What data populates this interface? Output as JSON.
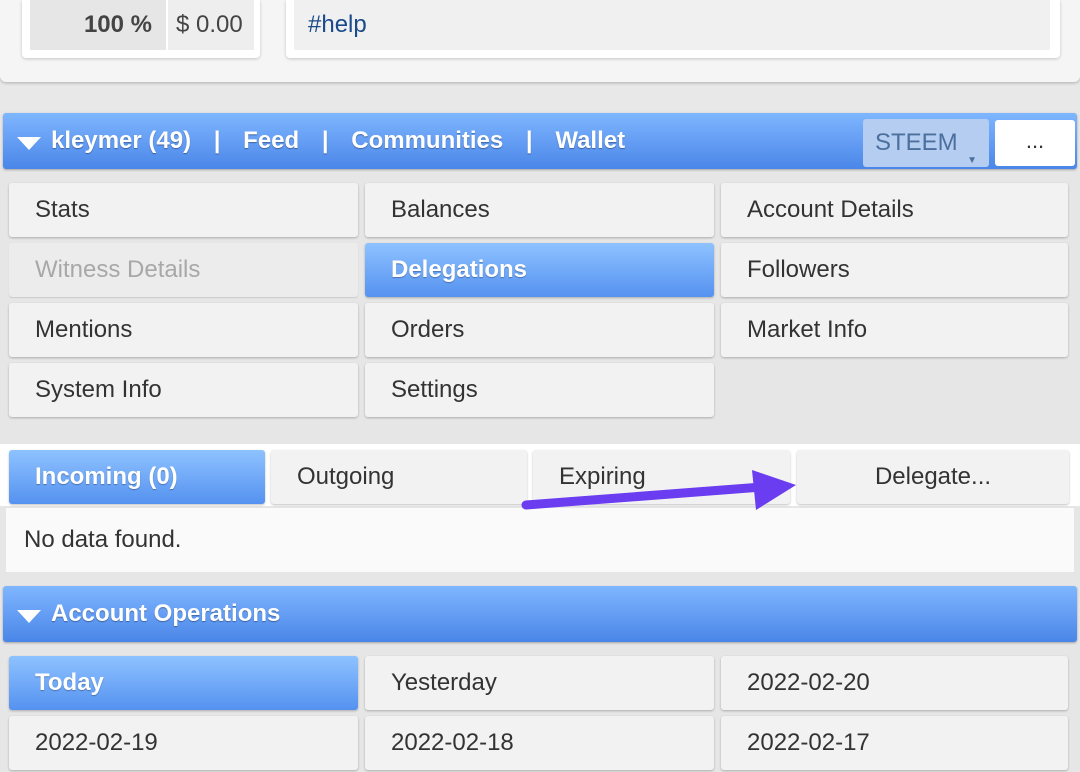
{
  "top": {
    "percent": "100 %",
    "usd": "$ 0.00",
    "tag": "#help"
  },
  "account_header": {
    "account": "kleymer (49)",
    "sep": "|",
    "feed": "Feed",
    "communities": "Communities",
    "wallet": "Wallet",
    "currency": "STEEM",
    "more": "..."
  },
  "menu": [
    "Stats",
    "Balances",
    "Account Details",
    "Witness Details",
    "Delegations",
    "Followers",
    "Mentions",
    "Orders",
    "Market Info",
    "System Info",
    "Settings"
  ],
  "delegation_tabs": {
    "incoming": "Incoming (0)",
    "outgoing": "Outgoing",
    "expiring": "Expiring",
    "delegate": "Delegate..."
  },
  "no_data": "No data found.",
  "operations": {
    "title": "Account Operations",
    "days": [
      "Today",
      "Yesterday",
      "2022-02-20",
      "2022-02-19",
      "2022-02-18",
      "2022-02-17"
    ]
  },
  "colors": {
    "accent": "#4a86e8",
    "annotation_arrow": "#6a3df0"
  }
}
